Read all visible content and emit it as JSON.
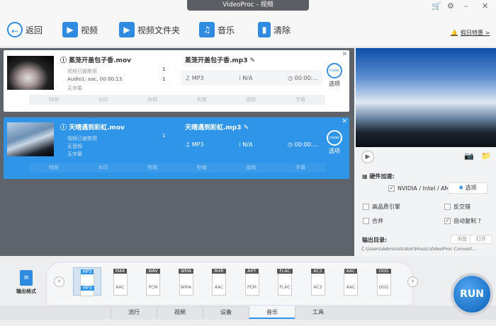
{
  "window": {
    "title": "VideoProc - 视频",
    "cart_icon": "cart-icon",
    "settings_icon": "gear-icon",
    "minimize": "–",
    "close": "✕"
  },
  "toolbar": {
    "back": "返回",
    "video": "视频",
    "video_folder": "视频文件夹",
    "music": "音乐",
    "clear": "清除",
    "promo": "假日特惠 >"
  },
  "files": [
    {
      "name": "蒸笼开盖包子香.mov",
      "video": "视频已被禁用",
      "audio": "Audio1: aac, 00:00:13",
      "subtitle": "无字幕",
      "audio_count": "1",
      "track_count": "1",
      "output_name": "蒸笼开盖包子香.mp3",
      "format": "MP3",
      "size": "N/A",
      "duration": "00:00:...",
      "options": "选项"
    },
    {
      "name": "天晴遇到彩虹.mov",
      "video": "视频已被禁用",
      "audio": "无音频",
      "subtitle": "无字幕",
      "track_count": "1",
      "output_name": "天晴遇到彩虹.mp3",
      "format": "MP3",
      "size": "N/A",
      "duration": "00:00:...",
      "options": "选项"
    }
  ],
  "card_actions": [
    "特效",
    "水印",
    "剪辑",
    "剪裁",
    "旋转",
    "字幕"
  ],
  "settings": {
    "hw_accel": "硬件加速:",
    "nvidia": "NVIDIA / Intel / AMD",
    "options": "选项",
    "high_quality": "高品质引擎",
    "deinterlace": "反交错",
    "merge": "合并",
    "auto_copy": "自动复制 ?",
    "output_dir_label": "输出目录:",
    "browse": "浏览",
    "open": "打开",
    "output_path": "C:\\Users\\Administrator\\Music\\VideoProc Convert..."
  },
  "output_format_label": "输出格式",
  "formats": [
    {
      "tag": "MP3",
      "codec": "MP3"
    },
    {
      "tag": "M4A",
      "codec": "AAC"
    },
    {
      "tag": "WAV",
      "codec": "PCM"
    },
    {
      "tag": "WMA",
      "codec": "WMA"
    },
    {
      "tag": "M4R",
      "codec": "AAC"
    },
    {
      "tag": "AIFF",
      "codec": "PCM"
    },
    {
      "tag": "FLAC",
      "codec": "FLAC"
    },
    {
      "tag": "AC3",
      "codec": "AC3"
    },
    {
      "tag": "AAC",
      "codec": "AAC"
    },
    {
      "tag": "OGG",
      "codec": "OGG"
    }
  ],
  "tabs": [
    "流行",
    "视频",
    "设备",
    "音乐",
    "工具"
  ],
  "active_tab": "音乐",
  "run": "RUN",
  "colors": {
    "accent": "#2f95e8",
    "list_bg": "#5f646b"
  }
}
